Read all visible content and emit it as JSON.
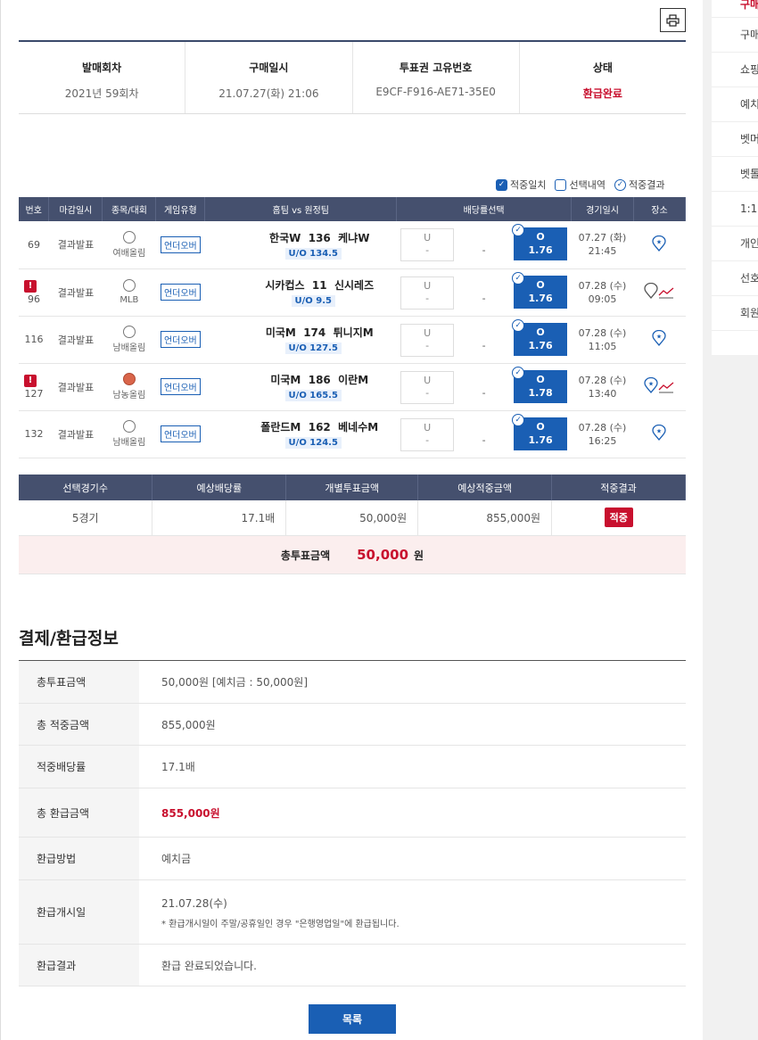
{
  "sidebar": {
    "items": [
      {
        "label": "구매"
      },
      {
        "label": "구매"
      },
      {
        "label": "쇼핑"
      },
      {
        "label": "예치"
      },
      {
        "label": "벳머"
      },
      {
        "label": "벳톨"
      },
      {
        "label": "1:1"
      },
      {
        "label": "개인"
      },
      {
        "label": "선호"
      },
      {
        "label": "회원"
      }
    ]
  },
  "info": {
    "round_label": "발매회차",
    "round_value": "2021년 59회차",
    "purchase_label": "구매일시",
    "purchase_value": "21.07.27(화) 21:06",
    "ticket_label": "투표권 고유번호",
    "ticket_value": "E9CF-F916-AE71-35E0",
    "status_label": "상태",
    "status_value": "환급완료"
  },
  "legend": {
    "match": "적중일치",
    "selection": "선택내역",
    "result": "적중결과"
  },
  "games": {
    "headers": [
      "번호",
      "마감일시",
      "종목/대회",
      "게임유형",
      "홈팀 vs 원정팀",
      "배당률선택",
      "경기일시",
      "장소"
    ],
    "rows": [
      {
        "no": "69",
        "deadline": "결과발표",
        "sport": "여배올림",
        "type": "언더오버",
        "home": "한국W",
        "line": "136",
        "away": "케냐W",
        "uo": "U/O 134.5",
        "u": "U",
        "u_odd": "-",
        "mid": "-",
        "o": "O",
        "o_odd": "1.76",
        "date": "07.27 (화)",
        "time": "21:45"
      },
      {
        "no": "96",
        "deadline": "결과발표",
        "sport": "MLB",
        "type": "언더오버",
        "home": "시카컵스",
        "line": "11",
        "away": "신시레즈",
        "uo": "U/O 9.5",
        "u": "U",
        "u_odd": "-",
        "mid": "-",
        "o": "O",
        "o_odd": "1.76",
        "date": "07.28 (수)",
        "time": "09:05"
      },
      {
        "no": "116",
        "deadline": "결과발표",
        "sport": "남배올림",
        "type": "언더오버",
        "home": "미국M",
        "line": "174",
        "away": "튀니지M",
        "uo": "U/O 127.5",
        "u": "U",
        "u_odd": "-",
        "mid": "-",
        "o": "O",
        "o_odd": "1.76",
        "date": "07.28 (수)",
        "time": "11:05"
      },
      {
        "no": "127",
        "deadline": "결과발표",
        "sport": "남농올림",
        "type": "언더오버",
        "home": "미국M",
        "line": "186",
        "away": "이란M",
        "uo": "U/O 165.5",
        "u": "U",
        "u_odd": "-",
        "mid": "-",
        "o": "O",
        "o_odd": "1.78",
        "date": "07.28 (수)",
        "time": "13:40"
      },
      {
        "no": "132",
        "deadline": "결과발표",
        "sport": "남배올림",
        "type": "언더오버",
        "home": "폴란드M",
        "line": "162",
        "away": "베네수M",
        "uo": "U/O 124.5",
        "u": "U",
        "u_odd": "-",
        "mid": "-",
        "o": "O",
        "o_odd": "1.76",
        "date": "07.28 (수)",
        "time": "16:25"
      }
    ]
  },
  "summary": {
    "headers": [
      "선택경기수",
      "예상배당률",
      "개별투표금액",
      "예상적중금액",
      "적중결과"
    ],
    "games": "5경기",
    "odds": "17.1배",
    "bet": "50,000원",
    "expected": "855,000원",
    "result": "적중",
    "total_label": "총투표금액",
    "total_amount": "50,000",
    "total_unit": "원"
  },
  "payment": {
    "title": "결제/환급정보",
    "rows": [
      {
        "label": "총투표금액",
        "value": "50,000원 [예치금 : 50,000원]"
      },
      {
        "label": "총 적중금액",
        "value": "855,000원"
      },
      {
        "label": "적중배당률",
        "value": "17.1배"
      },
      {
        "label": "총 환급금액",
        "value": "855,000원"
      },
      {
        "label": "환급방법",
        "value": "예치금"
      },
      {
        "label": "환급개시일",
        "value": "21.07.28(수)",
        "note": "* 환급개시일이 주말/공휴일인 경우 \"은행영업일\"에 환급됩니다."
      },
      {
        "label": "환급결과",
        "value": "환급 완료되었습니다."
      }
    ]
  },
  "list_button": "목록",
  "colors": {
    "accent": "#1a5fb4",
    "header": "#45506e",
    "red": "#c8102e"
  }
}
